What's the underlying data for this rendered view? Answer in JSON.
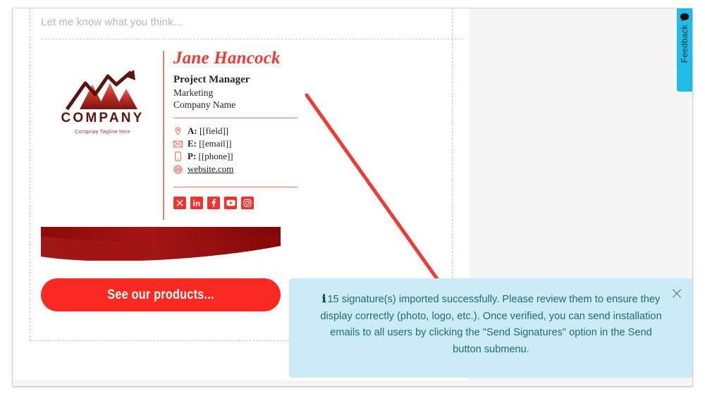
{
  "editor": {
    "reply_placeholder": "Let me know what you think..."
  },
  "signature": {
    "logo": {
      "company_name": "COMPANY",
      "tagline": "Compnay Tagline here",
      "mark_icon": "mountains-arrow-logo-icon"
    },
    "person": {
      "name": "Jane Hancock",
      "title": "Project Manager",
      "department": "Marketing",
      "company": "Company Name"
    },
    "contacts": [
      {
        "icon": "location-pin-icon",
        "label": "A:",
        "value": "[[field]]"
      },
      {
        "icon": "envelope-icon",
        "label": "E:",
        "value": "[[email]]"
      },
      {
        "icon": "mobile-phone-icon",
        "label": "P:",
        "value": "[[phone]]"
      },
      {
        "icon": "globe-icon",
        "label": "",
        "value": "website.com"
      }
    ],
    "social_icons": [
      {
        "name": "x-twitter-icon",
        "glyph": "X"
      },
      {
        "name": "linkedin-icon",
        "glyph": "in"
      },
      {
        "name": "facebook-icon",
        "glyph": "f"
      },
      {
        "name": "youtube-icon",
        "glyph": "▶"
      },
      {
        "name": "instagram-icon",
        "glyph": "◎"
      }
    ],
    "cta_label": "See our products...",
    "colors": {
      "accent_red": "#f23a32",
      "button_red": "#fa2a22",
      "banner_dark_red": "#9b0d0d",
      "rule_red": "#f2766c"
    }
  },
  "toast": {
    "info_icon": "info-icon",
    "message": "15 signature(s) imported successfully. Please review them to ensure they display correctly (photo, logo, etc.). Once verified, you can send installation emails to all users by clicking the \"Send Signatures\" option in the Send button submenu.",
    "close_icon": "close-icon",
    "background_color": "#cbecf7",
    "text_color": "#1f6a7a"
  },
  "feedback_tab": {
    "label": "Feedback",
    "icon": "speech-bubble-icon",
    "color": "#21bbe8"
  }
}
